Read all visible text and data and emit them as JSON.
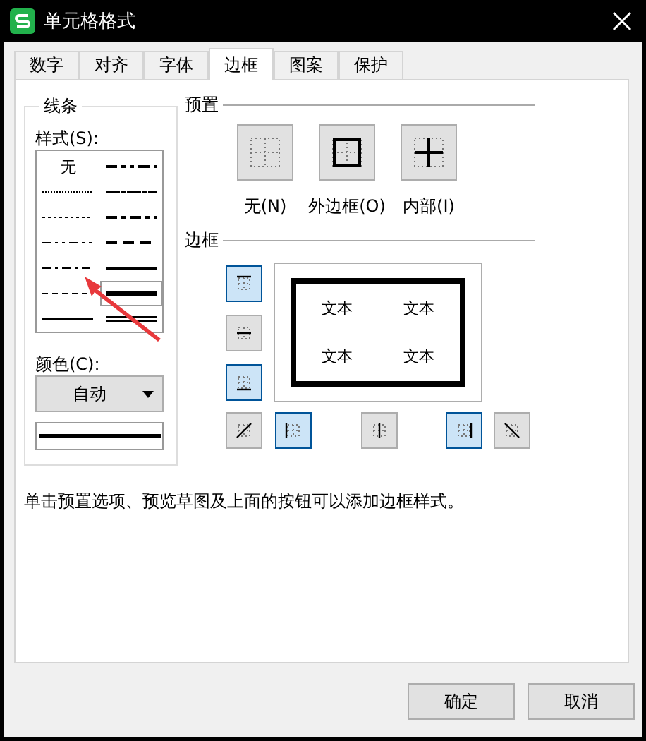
{
  "window": {
    "title": "单元格格式"
  },
  "tabs": [
    {
      "label": "数字",
      "selected": false
    },
    {
      "label": "对齐",
      "selected": false
    },
    {
      "label": "字体",
      "selected": false
    },
    {
      "label": "边框",
      "selected": true
    },
    {
      "label": "图案",
      "selected": false
    },
    {
      "label": "保护",
      "selected": false
    }
  ],
  "line_group": {
    "title": "线条",
    "style_label": "样式(S):",
    "styles": [
      {
        "kind": "none",
        "text": "无",
        "selected": false
      },
      {
        "kind": "medium-dashdotdot",
        "selected": false
      },
      {
        "kind": "hair",
        "selected": false
      },
      {
        "kind": "slant-dashdot",
        "selected": false
      },
      {
        "kind": "dotted",
        "selected": false
      },
      {
        "kind": "medium-dashdot",
        "selected": false
      },
      {
        "kind": "dashdotdot",
        "selected": false
      },
      {
        "kind": "medium-dashed",
        "selected": false
      },
      {
        "kind": "dashdot",
        "selected": false
      },
      {
        "kind": "medium",
        "selected": false
      },
      {
        "kind": "dashed",
        "selected": false
      },
      {
        "kind": "thick",
        "selected": true
      },
      {
        "kind": "thin",
        "selected": false
      },
      {
        "kind": "double",
        "selected": false
      }
    ],
    "color_label": "颜色(C):",
    "color_value": "自动"
  },
  "presets": {
    "title": "预置",
    "items": [
      {
        "kind": "none",
        "label": "无(N)"
      },
      {
        "kind": "outline",
        "label": "外边框(O)"
      },
      {
        "kind": "inside",
        "label": "内部(I)"
      }
    ]
  },
  "border": {
    "title": "边框",
    "side_buttons": [
      {
        "kind": "top",
        "on": true
      },
      {
        "kind": "hmid",
        "on": false
      },
      {
        "kind": "bottom",
        "on": true
      }
    ],
    "bottom_buttons": [
      {
        "kind": "diag-up",
        "on": false
      },
      {
        "kind": "left",
        "on": true
      },
      {
        "kind": "vmid",
        "on": false
      },
      {
        "kind": "right",
        "on": true
      },
      {
        "kind": "diag-down",
        "on": false
      }
    ],
    "preview_texts": [
      "文本",
      "文本",
      "文本",
      "文本"
    ]
  },
  "hint": "单击预置选项、预览草图及上面的按钮可以添加边框样式。",
  "buttons": [
    "确定",
    "取消"
  ]
}
